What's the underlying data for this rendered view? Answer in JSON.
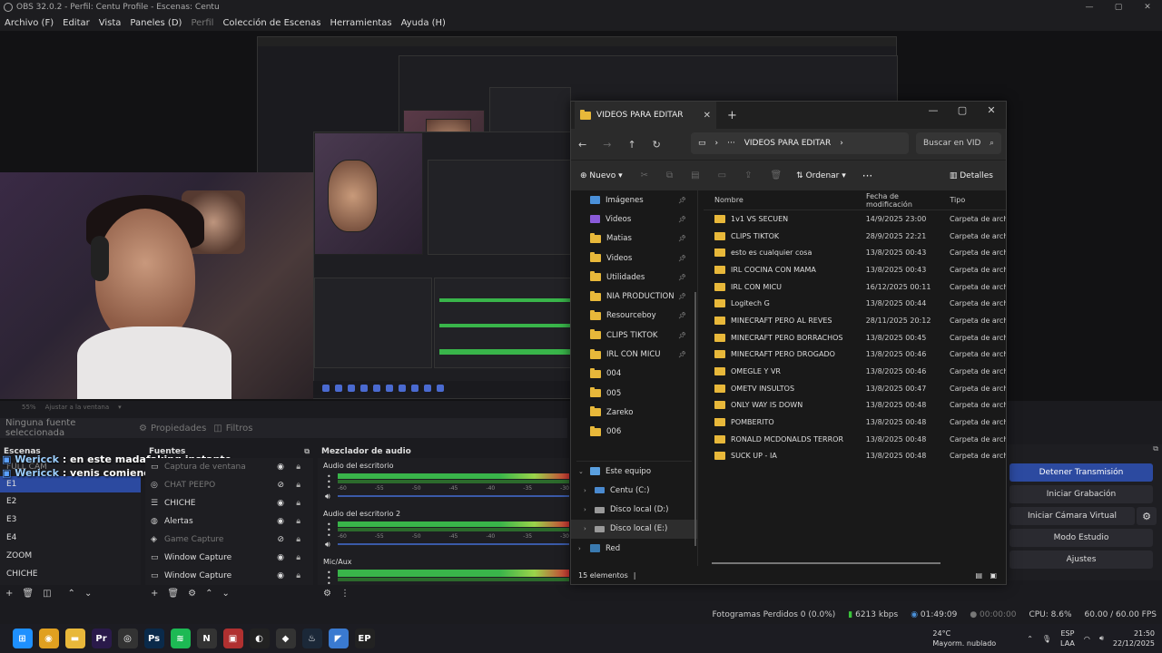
{
  "obs": {
    "title": "OBS 32.0.2 - Perfil: Centu Profile - Escenas: Centu",
    "menu": [
      "Archivo (F)",
      "Editar",
      "Vista",
      "Paneles (D)",
      "Perfil",
      "Colección de Escenas",
      "Herramientas",
      "Ayuda (H)"
    ],
    "zoom": "55%",
    "zoom_fit": "Ajustar a la ventana",
    "no_source": "Ninguna fuente seleccionada",
    "properties_label": "Propiedades",
    "filters_label": "Filtros",
    "scenes_title": "Escenas",
    "scenes": [
      "FULL CAM",
      "E1",
      "E2",
      "E3",
      "E4",
      "ZOOM",
      "CHICHE"
    ],
    "sources_title": "Fuentes",
    "sources": [
      {
        "name": "Captura de ventana",
        "icon": "window-icon",
        "dim": false
      },
      {
        "name": "CHAT PEEPO",
        "icon": "browser-icon",
        "dim": true
      },
      {
        "name": "CHICHE",
        "icon": "list-icon",
        "dim": false
      },
      {
        "name": "Alertas",
        "icon": "globe-icon",
        "dim": false
      },
      {
        "name": "Game Capture",
        "icon": "gamepad-icon",
        "dim": true
      },
      {
        "name": "Window Capture",
        "icon": "window-icon",
        "dim": false
      },
      {
        "name": "Window Capture",
        "icon": "window-icon",
        "dim": false
      }
    ],
    "chat": [
      {
        "user": "Wericck",
        "text": " : en este madafaking instante"
      },
      {
        "user": "Wericck",
        "text": " : venis comiendo mal o que"
      }
    ],
    "mixer_title": "Mezclador de audio",
    "tracks": [
      "Audio del escritorio",
      "Audio del escritorio 2",
      "Mic/Aux"
    ],
    "ticks": [
      "-60",
      "-55",
      "-50",
      "-45",
      "-40",
      "-35",
      "-30"
    ],
    "controls": {
      "stop_stream": "Detener Transmisión",
      "start_record": "Iniciar Grabación",
      "start_vcam": "Iniciar Cámara Virtual",
      "studio_mode": "Modo Estudio",
      "settings": "Ajustes"
    },
    "status": {
      "dropped": "Fotogramas Perdidos 0 (0.0%)",
      "bitrate": "6213 kbps",
      "stream_time": "01:49:09",
      "rec_time": "00:00:00",
      "cpu": "CPU: 8.6%",
      "fps": "60.00 / 60.00 FPS"
    }
  },
  "explorer": {
    "tab_title": "VIDEOS PARA EDITAR",
    "breadcrumb": "VIDEOS PARA EDITAR",
    "search_placeholder": "Buscar en VID",
    "new_label": "Nuevo",
    "sort_label": "Ordenar",
    "details_label": "Detalles",
    "col_name": "Nombre",
    "col_date": "Fecha de modificación",
    "col_type": "Tipo",
    "nav": [
      {
        "label": "Imágenes",
        "icon": "blue",
        "pin": true
      },
      {
        "label": "Videos",
        "icon": "blue",
        "pin": true
      },
      {
        "label": "Matias",
        "icon": "folder",
        "pin": true
      },
      {
        "label": "Videos",
        "icon": "folder",
        "pin": true
      },
      {
        "label": "Utilidades",
        "icon": "folder",
        "pin": true
      },
      {
        "label": "NIA PRODUCTION",
        "icon": "folder",
        "pin": true
      },
      {
        "label": "Resourceboy",
        "icon": "folder",
        "pin": true
      },
      {
        "label": "CLIPS TIKTOK",
        "icon": "folder",
        "pin": true
      },
      {
        "label": "IRL CON MICU",
        "icon": "folder",
        "pin": true
      },
      {
        "label": "004",
        "icon": "folder",
        "pin": false
      },
      {
        "label": "005",
        "icon": "folder",
        "pin": false
      },
      {
        "label": "Zareko",
        "icon": "folder",
        "pin": false
      },
      {
        "label": "006",
        "icon": "folder",
        "pin": false
      }
    ],
    "tree": [
      {
        "label": "Este equipo",
        "icon": "pc",
        "chev": "⌄",
        "indent": 0
      },
      {
        "label": "Centu (C:)",
        "icon": "drive",
        "chev": "›",
        "indent": 1
      },
      {
        "label": "Disco local (D:)",
        "icon": "drive",
        "chev": "›",
        "indent": 1
      },
      {
        "label": "Disco local (E:)",
        "icon": "drive",
        "chev": "›",
        "indent": 1,
        "sel": true
      },
      {
        "label": "Red",
        "icon": "net",
        "chev": "›",
        "indent": 0
      }
    ],
    "files": [
      {
        "name": "1v1 VS SECUEN",
        "date": "14/9/2025 23:00",
        "type": "Carpeta de archivos"
      },
      {
        "name": "CLIPS TIKTOK",
        "date": "28/9/2025 22:21",
        "type": "Carpeta de archivos"
      },
      {
        "name": "esto es cualquier cosa",
        "date": "13/8/2025 00:43",
        "type": "Carpeta de archivos"
      },
      {
        "name": "IRL COCINA CON MAMA",
        "date": "13/8/2025 00:43",
        "type": "Carpeta de archivos"
      },
      {
        "name": "IRL CON MICU",
        "date": "16/12/2025 00:11",
        "type": "Carpeta de archivos"
      },
      {
        "name": "Logitech G",
        "date": "13/8/2025 00:44",
        "type": "Carpeta de archivos"
      },
      {
        "name": "MINECRAFT PERO AL REVES",
        "date": "28/11/2025 20:12",
        "type": "Carpeta de archivos"
      },
      {
        "name": "MINECRAFT PERO BORRACHOS",
        "date": "13/8/2025 00:45",
        "type": "Carpeta de archivos"
      },
      {
        "name": "MINECRAFT PERO DROGADO",
        "date": "13/8/2025 00:46",
        "type": "Carpeta de archivos"
      },
      {
        "name": "OMEGLE Y VR",
        "date": "13/8/2025 00:46",
        "type": "Carpeta de archivos"
      },
      {
        "name": "OMETV INSULTOS",
        "date": "13/8/2025 00:47",
        "type": "Carpeta de archivos"
      },
      {
        "name": "ONLY WAY IS DOWN",
        "date": "13/8/2025 00:48",
        "type": "Carpeta de archivos"
      },
      {
        "name": "POMBERITO",
        "date": "13/8/2025 00:48",
        "type": "Carpeta de archivos"
      },
      {
        "name": "RONALD MCDONALDS TERROR",
        "date": "13/8/2025 00:48",
        "type": "Carpeta de archivos"
      },
      {
        "name": "SUCK UP - IA",
        "date": "13/8/2025 00:48",
        "type": "Carpeta de archivos"
      }
    ],
    "item_count": "15 elementos"
  },
  "taskbar": {
    "weather_temp": "24°C",
    "weather_desc": "Mayorm. nublado",
    "lang1": "ESP",
    "lang2": "LAA",
    "time": "21:50",
    "date": "22/12/2025",
    "apps": [
      {
        "name": "windows-start-icon",
        "label": "⊞",
        "color": "#1e90ff"
      },
      {
        "name": "chrome-icon",
        "label": "◉",
        "color": "#e0a020"
      },
      {
        "name": "file-explorer-icon",
        "label": "▬",
        "color": "#e8b83a"
      },
      {
        "name": "premiere-icon",
        "label": "Pr",
        "color": "#2a1a4a"
      },
      {
        "name": "obs-icon",
        "label": "◎",
        "color": "#333"
      },
      {
        "name": "photoshop-icon",
        "label": "Ps",
        "color": "#0a2a4a"
      },
      {
        "name": "spotify-icon",
        "label": "≋",
        "color": "#1db954"
      },
      {
        "name": "notion-icon",
        "label": "N",
        "color": "#333"
      },
      {
        "name": "app-icon",
        "label": "▣",
        "color": "#b03030"
      },
      {
        "name": "capcut-icon",
        "label": "◐",
        "color": "#222"
      },
      {
        "name": "app-icon-2",
        "label": "◆",
        "color": "#333"
      },
      {
        "name": "steam-icon",
        "label": "♨",
        "color": "#1b2838"
      },
      {
        "name": "app-icon-3",
        "label": "◤",
        "color": "#3a7ad0"
      },
      {
        "name": "epic-icon",
        "label": "EP",
        "color": "#222"
      }
    ]
  }
}
